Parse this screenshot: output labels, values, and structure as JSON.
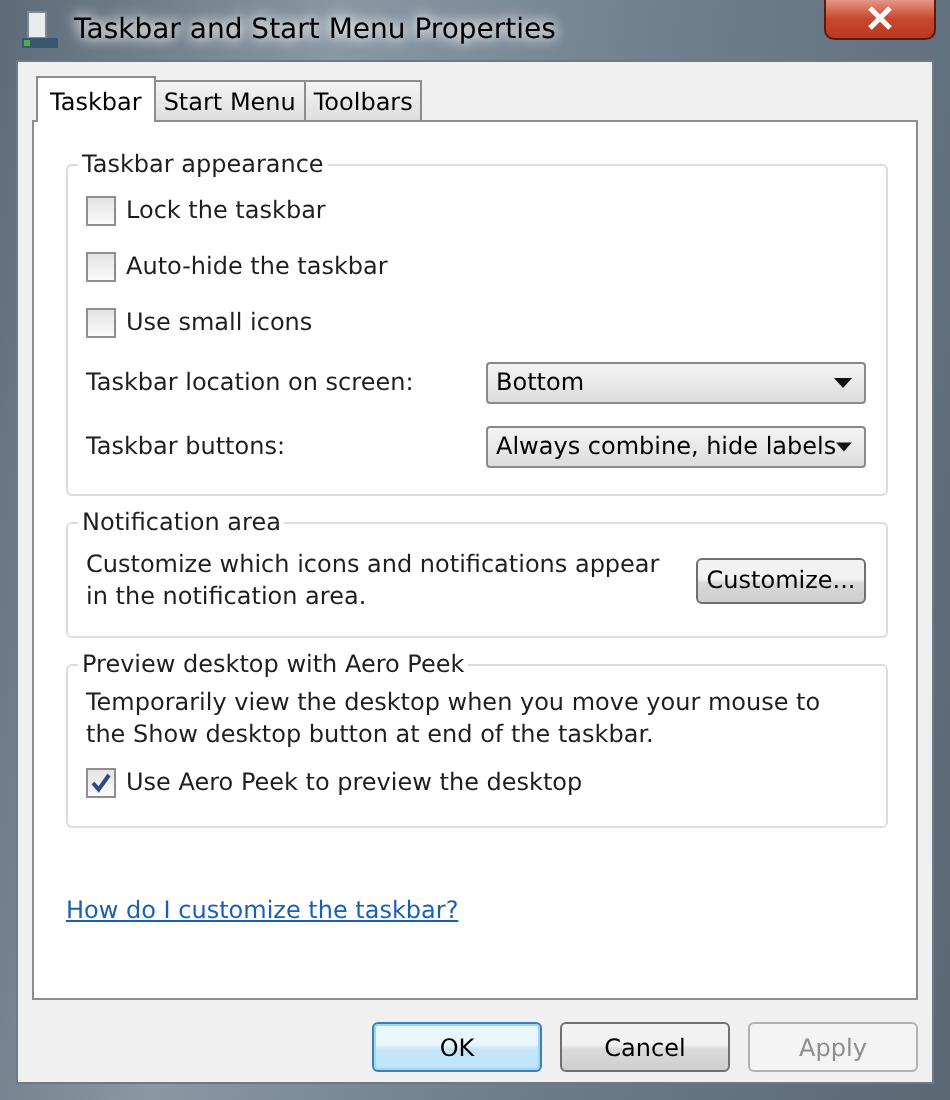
{
  "window": {
    "title": "Taskbar and Start Menu Properties"
  },
  "tabs": [
    {
      "label": "Taskbar",
      "selected": true
    },
    {
      "label": "Start Menu",
      "selected": false
    },
    {
      "label": "Toolbars",
      "selected": false
    }
  ],
  "groups": [
    {
      "title": "Taskbar appearance",
      "items": [
        {
          "kind": "checkbox",
          "label": "Lock the taskbar",
          "checked": false
        },
        {
          "kind": "checkbox",
          "label": "Auto-hide the taskbar",
          "checked": false
        },
        {
          "kind": "checkbox",
          "label": "Use small icons",
          "checked": false
        },
        {
          "kind": "dropdown",
          "label": "Taskbar location on screen:",
          "value": "Bottom"
        },
        {
          "kind": "dropdown",
          "label": "Taskbar buttons:",
          "value": "Always combine, hide labels"
        }
      ]
    },
    {
      "title": "Notification area",
      "items": [
        {
          "kind": "text_button",
          "text": "Customize which icons and notifications appear in the notification area.",
          "button": "Customize..."
        }
      ]
    },
    {
      "title": "Preview desktop with Aero Peek",
      "items": [
        {
          "kind": "text",
          "text": "Temporarily view the desktop when you move your mouse to the Show desktop button at end of the taskbar."
        },
        {
          "kind": "checkbox",
          "label": "Use Aero Peek to preview the desktop",
          "checked": true
        }
      ]
    }
  ],
  "help_link": "How do I customize the taskbar?",
  "buttons": [
    {
      "label": "OK",
      "default": true,
      "disabled": false
    },
    {
      "label": "Cancel",
      "default": false,
      "disabled": false
    },
    {
      "label": "Apply",
      "default": false,
      "disabled": true
    }
  ]
}
